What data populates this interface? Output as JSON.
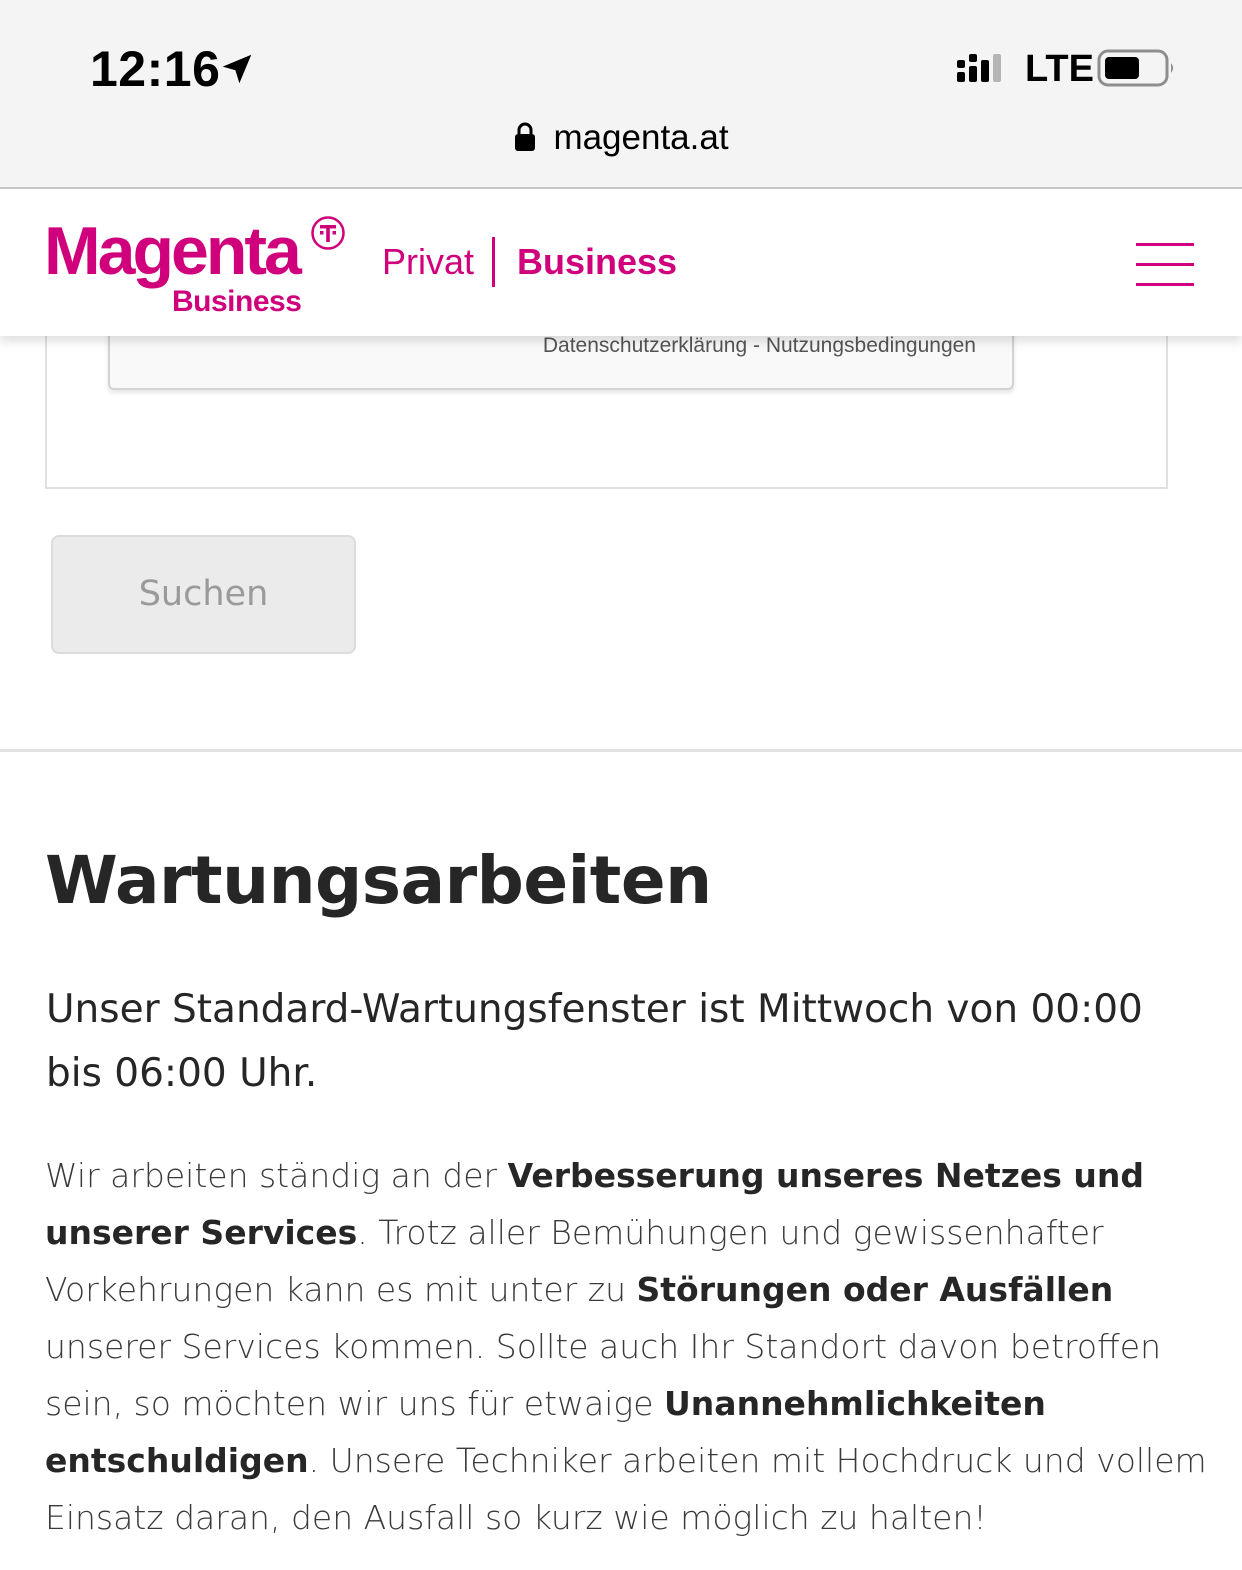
{
  "status_bar": {
    "time": "12:16",
    "network": "LTE"
  },
  "browser": {
    "url": "magenta.at"
  },
  "header": {
    "logo_word": "Magenta",
    "logo_sub": "Business",
    "nav_privat": "Privat",
    "nav_business": "Business"
  },
  "form": {
    "recaptcha_privacy": "Datenschutzerklärung",
    "recaptcha_separator": " - ",
    "recaptcha_terms": "Nutzungsbedingungen",
    "search_button": "Suchen"
  },
  "content": {
    "heading": "Wartungsarbeiten",
    "lead": "Unser Standard-Wartungsfenster ist Mittwoch von 00:00 bis 06:00 Uhr.",
    "body": {
      "p1": "Wir arbeiten ständig an der ",
      "b1": "Verbesserung unseres Netzes und unserer Services",
      "p2": ". Trotz aller Bemühungen und gewissenhafter Vorkehrungen kann es mit unter zu ",
      "b2": "Störungen oder Ausfällen",
      "p3": " unserer Services kommen. Sollte auch Ihr Standort davon betroffen sein, so möchten wir uns für etwaige ",
      "b3": "Unannehmlichkeiten entschuldigen",
      "p4": ". Unsere Techniker arbeiten mit Hochdruck und vollem Einsatz daran, den Ausfall so kurz wie möglich zu halten!"
    }
  },
  "colors": {
    "brand_magenta": "#d0007c",
    "text_dark": "#262626",
    "button_bg": "#ebebeb"
  },
  "icons": [
    "location-arrow-icon",
    "signal-icon",
    "battery-icon",
    "lock-icon",
    "telekom-t-icon",
    "hamburger-menu-icon"
  ]
}
